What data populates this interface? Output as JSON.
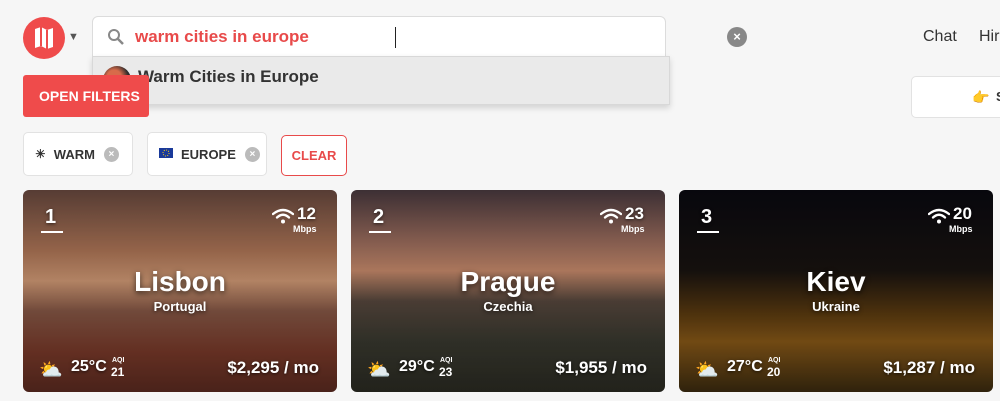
{
  "logo": {
    "icon": "map-logo-icon",
    "color": "#ef4b4b"
  },
  "search": {
    "value": "warm cities in europe",
    "suggestion": "Warm Cities in Europe"
  },
  "nav": {
    "chat": "Chat",
    "hire": "Hir"
  },
  "buttons": {
    "open_filters": "OPEN FILTERS",
    "clear": "CLEAR"
  },
  "right_box": {
    "label": "S"
  },
  "filters": [
    {
      "label": "WARM",
      "icon": "sun-icon"
    },
    {
      "label": "EUROPE",
      "icon": "eu-flag-icon"
    }
  ],
  "cities": [
    {
      "rank": "1",
      "name": "Lisbon",
      "country": "Portugal",
      "mbps": "12",
      "mbps_unit": "Mbps",
      "temp": "25°C",
      "aqi_label": "AQI",
      "aqi": "21",
      "cost": "$2,295 / mo"
    },
    {
      "rank": "2",
      "name": "Prague",
      "country": "Czechia",
      "mbps": "23",
      "mbps_unit": "Mbps",
      "temp": "29°C",
      "aqi_label": "AQI",
      "aqi": "23",
      "cost": "$1,955 / mo"
    },
    {
      "rank": "3",
      "name": "Kiev",
      "country": "Ukraine",
      "mbps": "20",
      "mbps_unit": "Mbps",
      "temp": "27°C",
      "aqi_label": "AQI",
      "aqi": "20",
      "cost": "$1,287 / mo"
    }
  ]
}
